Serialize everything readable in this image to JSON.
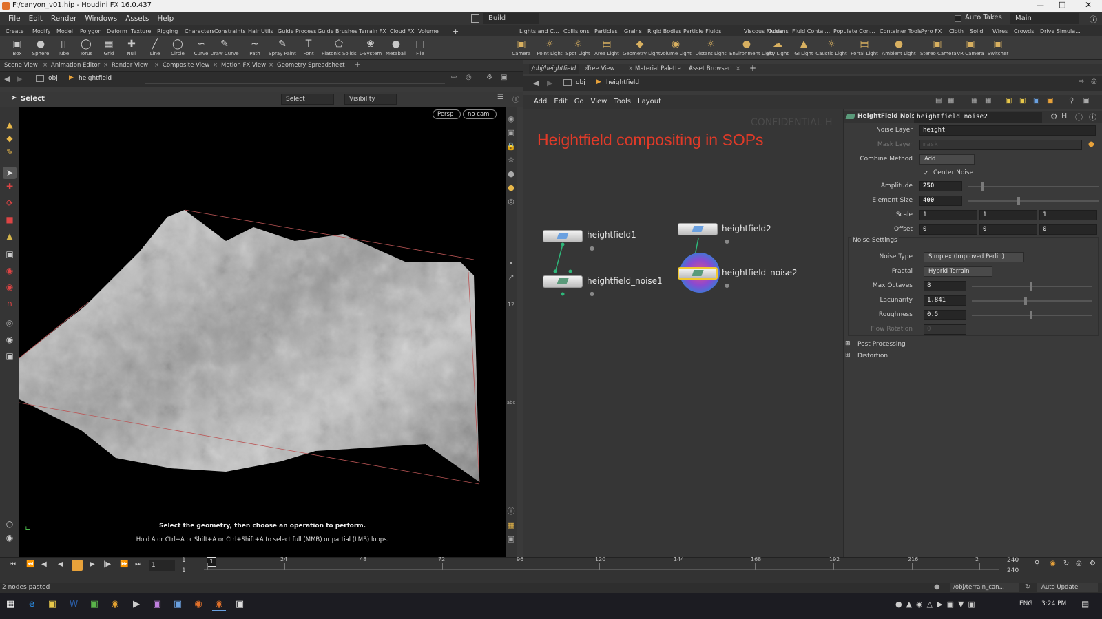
{
  "window": {
    "title": "F:/canyon_v01.hip - Houdini FX 16.0.437"
  },
  "menubar": {
    "items": [
      "File",
      "Edit",
      "Render",
      "Windows",
      "Assets",
      "Help"
    ],
    "desktop": "Build",
    "auto_takes": "Auto Takes",
    "main": "Main"
  },
  "shelf_tabs_left": [
    "Create",
    "Modify",
    "Model",
    "Polygon",
    "Deform",
    "Texture",
    "Rigging",
    "Characters",
    "Constraints",
    "Hair Utils",
    "Guide Process",
    "Guide Brushes",
    "Terrain FX",
    "Cloud FX",
    "Volume"
  ],
  "shelf_tools_left": [
    {
      "label": "Box",
      "icon": "box-icon"
    },
    {
      "label": "Sphere",
      "icon": "sphere-icon"
    },
    {
      "label": "Tube",
      "icon": "tube-icon"
    },
    {
      "label": "Torus",
      "icon": "torus-icon"
    },
    {
      "label": "Grid",
      "icon": "grid-icon"
    },
    {
      "label": "Null",
      "icon": "null-icon"
    },
    {
      "label": "Line",
      "icon": "line-icon"
    },
    {
      "label": "Circle",
      "icon": "circle-icon"
    },
    {
      "label": "Curve",
      "icon": "curve-icon"
    },
    {
      "label": "Draw Curve",
      "icon": "draw-curve-icon"
    },
    {
      "label": "Path",
      "icon": "path-icon"
    },
    {
      "label": "Spray Paint",
      "icon": "spray-paint-icon"
    },
    {
      "label": "Font",
      "icon": "font-icon"
    },
    {
      "label": "Platonic Solids",
      "icon": "platonic-icon"
    },
    {
      "label": "L-System",
      "icon": "lsystem-icon"
    },
    {
      "label": "Metaball",
      "icon": "metaball-icon"
    },
    {
      "label": "File",
      "icon": "file-icon"
    }
  ],
  "shelf_tabs_right": [
    "Lights and C...",
    "Collisions",
    "Particles",
    "Grains",
    "Rigid Bodies",
    "Particle Fluids",
    "Viscous Fluids",
    "Oceans",
    "Fluid Contai...",
    "Populate Con...",
    "Container Tools",
    "Pyro FX",
    "Cloth",
    "Solid",
    "Wires",
    "Crowds",
    "Drive Simula..."
  ],
  "shelf_tools_right": [
    {
      "label": "Camera",
      "icon": "camera-icon"
    },
    {
      "label": "Point Light",
      "icon": "point-light-icon"
    },
    {
      "label": "Spot Light",
      "icon": "spot-light-icon"
    },
    {
      "label": "Area Light",
      "icon": "area-light-icon"
    },
    {
      "label": "Geometry Light",
      "icon": "geometry-light-icon"
    },
    {
      "label": "Volume Light",
      "icon": "volume-light-icon"
    },
    {
      "label": "Distant Light",
      "icon": "distant-light-icon"
    },
    {
      "label": "Environment Light",
      "icon": "environment-light-icon"
    },
    {
      "label": "Sky Light",
      "icon": "sky-light-icon"
    },
    {
      "label": "GI Light",
      "icon": "gi-light-icon"
    },
    {
      "label": "Caustic Light",
      "icon": "caustic-light-icon"
    },
    {
      "label": "Portal Light",
      "icon": "portal-light-icon"
    },
    {
      "label": "Ambient Light",
      "icon": "ambient-light-icon"
    },
    {
      "label": "Stereo Camera",
      "icon": "stereo-camera-icon"
    },
    {
      "label": "VR Camera",
      "icon": "vr-camera-icon"
    },
    {
      "label": "Switcher",
      "icon": "switcher-icon"
    }
  ],
  "left_tabs": [
    "Scene View",
    "Animation Editor",
    "Render View",
    "Composite View",
    "Motion FX View",
    "Geometry Spreadsheet"
  ],
  "left_path": {
    "root": "obj",
    "node": "heightfield"
  },
  "viewport": {
    "select_label": "Select",
    "select_mode": "Select",
    "visibility": "Visibility",
    "persp": "Persp",
    "cam": "no cam",
    "hint1": "Select the geometry, then choose an operation to perform.",
    "hint2": "Hold A or Ctrl+A or Shift+A or Ctrl+Shift+A to select full (MMB) or partial (LMB) loops."
  },
  "right_tabs": [
    "/obj/heightfield",
    "Tree View",
    "Material Palette",
    "Asset Browser"
  ],
  "right_path": {
    "root": "obj",
    "node": "heightfield"
  },
  "network_menu": [
    "Add",
    "Edit",
    "Go",
    "View",
    "Tools",
    "Layout"
  ],
  "network": {
    "title": "Heightfield compositing in SOPs",
    "watermark": "CONFIDENTIAL H",
    "nodes": [
      "heightfield1",
      "heightfield_noise1",
      "heightfield2",
      "heightfield_noise2"
    ]
  },
  "params": {
    "node_type": "HeightField Noise",
    "node_name": "heightfield_noise2",
    "noise_layer_label": "Noise Layer",
    "noise_layer": "height",
    "mask_layer_label": "Mask Layer",
    "mask_layer": "mask",
    "combine_label": "Combine Method",
    "combine": "Add",
    "center_noise": "Center Noise",
    "amplitude_label": "Amplitude",
    "amplitude": "250",
    "element_size_label": "Element Size",
    "element_size": "400",
    "scale_label": "Scale",
    "scale": [
      "1",
      "1",
      "1"
    ],
    "offset_label": "Offset",
    "offset": [
      "0",
      "0",
      "0"
    ],
    "noise_settings": "Noise Settings",
    "noise_type_label": "Noise Type",
    "noise_type": "Simplex (Improved Perlin)",
    "fractal_label": "Fractal",
    "fractal": "Hybrid Terrain",
    "octaves_label": "Max Octaves",
    "octaves": "8",
    "lacunarity_label": "Lacunarity",
    "lacunarity": "1.841",
    "roughness_label": "Roughness",
    "roughness": "0.5",
    "flow_label": "Flow Rotation",
    "flow": "0",
    "post_processing": "Post Processing",
    "distortion": "Distortion"
  },
  "timeline": {
    "frame": "1",
    "start": "1",
    "start2": "1",
    "ticks": [
      "1",
      "24",
      "48",
      "72",
      "96",
      "120",
      "144",
      "168",
      "192",
      "216",
      "2"
    ],
    "end": "240",
    "end2": "240"
  },
  "status": {
    "message": "2 nodes pasted",
    "path": "/obj/terrain_can...",
    "auto_update": "Auto Update"
  },
  "taskbar": {
    "lang": "ENG",
    "time": "3:24 PM"
  }
}
